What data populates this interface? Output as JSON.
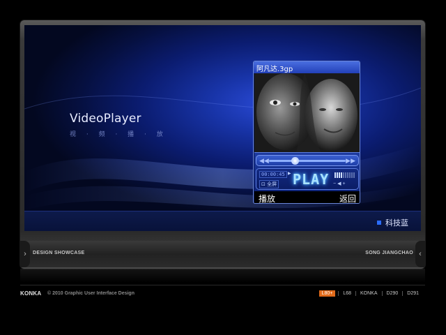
{
  "app": {
    "title": "VideoPlayer",
    "subtitle": "视 · 频 · 播 · 放"
  },
  "player": {
    "file_name": "阿凡达.3gp",
    "time": "00:00:45",
    "fullscreen_label": "全屏",
    "state_label": "PLAY",
    "seek_fraction": 0.34,
    "play_button": "播放",
    "back_button": "返回"
  },
  "skin": {
    "label": "科技蓝",
    "accent": "#2a6cff"
  },
  "showcase": {
    "left_label": "DESIGN SHOWCASE",
    "right_label": "SONG JIANGCHAO"
  },
  "footer": {
    "brand": "KONKA",
    "copyright": "© 2010 Graphic User Interface Design",
    "models": [
      "L80+",
      "L68",
      "KONKA",
      "D290",
      "D291"
    ],
    "active_model": "L80+",
    "active_color": "#e06a1a"
  }
}
